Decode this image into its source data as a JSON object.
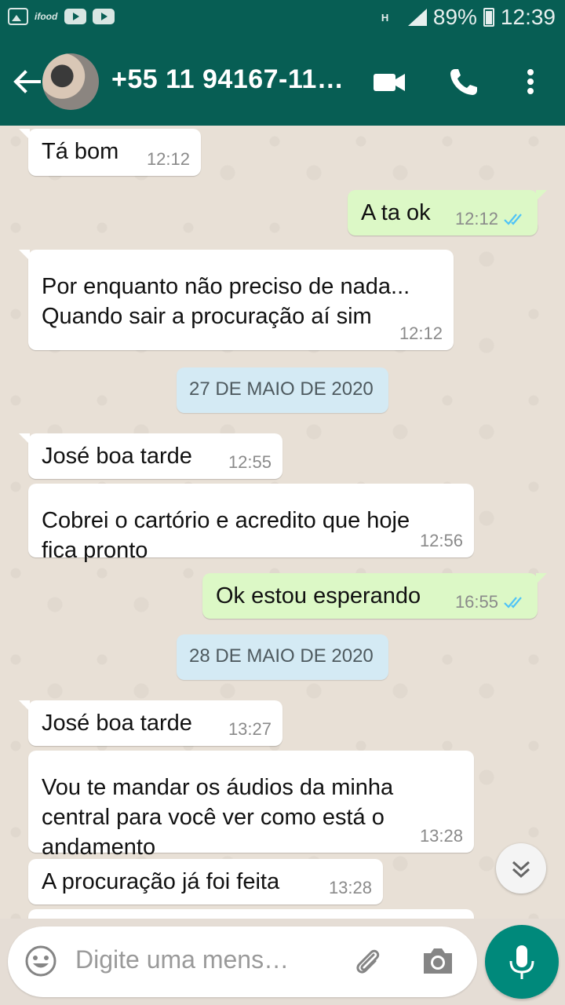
{
  "status_bar": {
    "app_label": "ifood",
    "battery": "89%",
    "time": "12:39",
    "network": "H"
  },
  "header": {
    "contact": "+55 11 94167-11…",
    "icons": [
      "back-arrow-icon",
      "video-call-icon",
      "phone-icon",
      "more-vert-icon"
    ]
  },
  "messages": [
    {
      "dir": "in",
      "text": "Tá bom",
      "time": "12:12"
    },
    {
      "dir": "out",
      "text": "A ta ok",
      "time": "12:12",
      "ticks": "read"
    },
    {
      "dir": "in",
      "text": "Por enquanto não preciso de nada...\nQuando sair a procuração aí sim",
      "time": "12:12"
    },
    {
      "dir": "date",
      "text": "27 DE MAIO DE 2020"
    },
    {
      "dir": "in",
      "text": "José boa tarde",
      "time": "12:55"
    },
    {
      "dir": "in",
      "text": "Cobrei o cartório e acredito que hoje\nfica pronto",
      "time": "12:56"
    },
    {
      "dir": "out",
      "text": "Ok estou esperando",
      "time": "16:55",
      "ticks": "read"
    },
    {
      "dir": "date",
      "text": "28 DE MAIO DE 2020"
    },
    {
      "dir": "in",
      "text": "José boa tarde",
      "time": "13:27"
    },
    {
      "dir": "in",
      "text": "Vou te mandar os áudios da minha\ncentral para você ver como está o\nandamento",
      "time": "13:28"
    },
    {
      "dir": "in",
      "text": "A procuração já foi feita",
      "time": "13:28"
    }
  ],
  "input": {
    "placeholder": "Digite uma mens…"
  },
  "colors": {
    "header": "#075e54",
    "outgoing_bubble": "#dcf8c6",
    "incoming_bubble": "#ffffff",
    "date_chip": "#d4eaf4",
    "read_ticks": "#4fc3f7",
    "mic_button": "#00897b"
  }
}
